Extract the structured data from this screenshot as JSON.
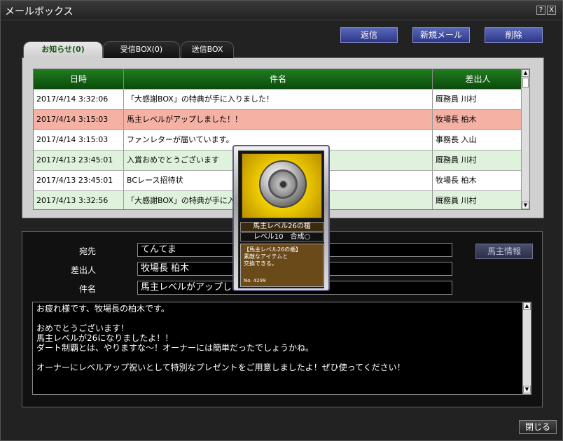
{
  "window": {
    "title": "メールボックス",
    "help": "?",
    "close": "X"
  },
  "toolbar": {
    "reply_label": "返信",
    "new_mail_label": "新規メール",
    "delete_label": "削除"
  },
  "tabs": [
    {
      "label": "お知らせ(0)",
      "active": true
    },
    {
      "label": "受信BOX(0)",
      "active": false
    },
    {
      "label": "送信BOX",
      "active": false
    }
  ],
  "mail_list": {
    "columns": [
      "日時",
      "件名",
      "差出人"
    ],
    "rows": [
      {
        "date": "2017/4/14 3:32:06",
        "subject": "「大感謝BOX」の特典が手に入りました！",
        "sender": "厩務員 川村",
        "bg": "#ffffff"
      },
      {
        "date": "2017/4/14 3:15:03",
        "subject": "馬主レベルがアップしました！！",
        "sender": "牧場長 柏木",
        "bg": "#f5b2a4"
      },
      {
        "date": "2017/4/14 3:15:03",
        "subject": "ファンレターが届いています。",
        "sender": "事務長 入山",
        "bg": "#ffffff"
      },
      {
        "date": "2017/4/13 23:45:01",
        "subject": "入賞おめでとうございます",
        "sender": "厩務員 川村",
        "bg": "#dff3dc"
      },
      {
        "date": "2017/4/13 23:45:01",
        "subject": "BCレース招待状",
        "sender": "牧場長 柏木",
        "bg": "#ffffff"
      },
      {
        "date": "2017/4/13 3:32:56",
        "subject": "「大感謝BOX」の特典が手に入",
        "sender": "厩務員 川村",
        "bg": "#dff3dc"
      }
    ]
  },
  "detail": {
    "to_label": "宛先",
    "to_value": "てんてま",
    "from_label": "差出人",
    "from_value": "牧場長 柏木",
    "subject_label": "件名",
    "subject_value": "馬主レベルがアップしま",
    "owner_info_label": "馬主情報",
    "body": "お疲れ様です、牧場長の柏木です。\n\nおめでとうございます！\n馬主レベルが26になりましたよ！！\nダート制覇とは、やりますな〜！オーナーには簡単だったでしょうかね。\n\nオーナーにレベルアップ祝いとして特別なプレゼントをご用意しましたよ！ぜひ使ってください！"
  },
  "card": {
    "name": "馬主レベル26の楯",
    "level": "レベル10　合成○",
    "description": "【馬主レベル26の楯】\n素敵なアイテムと\n交換できる。",
    "number": "No. 4299"
  },
  "footer": {
    "close_label": "閉じる"
  }
}
